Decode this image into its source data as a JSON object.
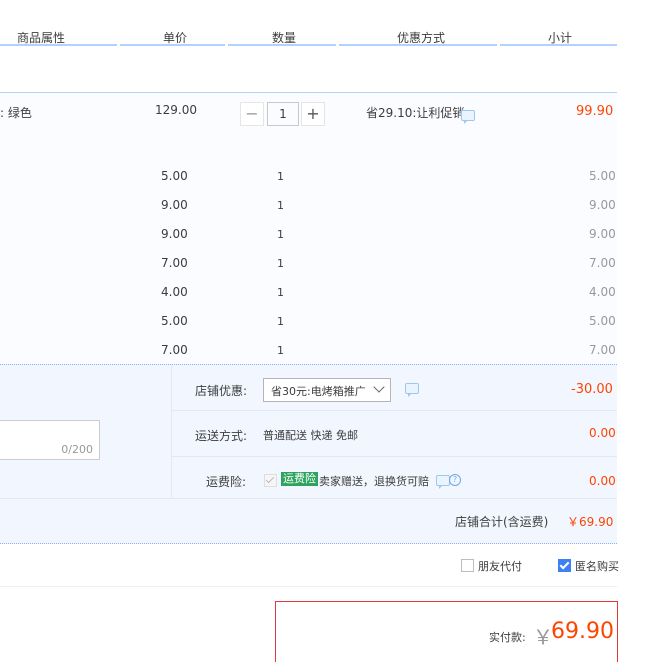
{
  "header": {
    "col_attr": "商品属性",
    "col_price": "单价",
    "col_qty": "数量",
    "col_promo": "优惠方式",
    "col_subtotal": "小计"
  },
  "main_item": {
    "attr": ": 绿色",
    "price": "129.00",
    "qty": "1",
    "minus": "−",
    "plus": "+",
    "promo": "省29.10:让利促销",
    "subtotal": "99.90"
  },
  "items": [
    {
      "price": "5.00",
      "qty": "1",
      "subtotal": "5.00"
    },
    {
      "price": "9.00",
      "qty": "1",
      "subtotal": "9.00"
    },
    {
      "price": "9.00",
      "qty": "1",
      "subtotal": "9.00"
    },
    {
      "price": "7.00",
      "qty": "1",
      "subtotal": "7.00"
    },
    {
      "price": "4.00",
      "qty": "1",
      "subtotal": "4.00"
    },
    {
      "price": "5.00",
      "qty": "1",
      "subtotal": "5.00"
    },
    {
      "price": "7.00",
      "qty": "1",
      "subtotal": "7.00"
    }
  ],
  "store": {
    "discount_label": "店铺优惠:",
    "discount_select": "省30元:电烤箱推广",
    "discount_amount": "-30.00",
    "shipping_label": "运送方式:",
    "shipping_value": "普通配送 快递 免邮",
    "shipping_amount": "0.00",
    "insurance_label": "运费险:",
    "insurance_badge": "运费险",
    "insurance_text": "卖家赠送，退换货可赔",
    "insurance_amount": "0.00",
    "message_counter": "0/200",
    "total_label": "店铺合计(含运费)",
    "total_value": "￥69.90"
  },
  "options": {
    "friend_pay": "朋友代付",
    "anonymous": "匿名购买"
  },
  "payment": {
    "label": "实付款:",
    "currency": "￥",
    "amount": "69.90"
  },
  "colors": {
    "accent": "#f40",
    "header_line": "#b2d1ff",
    "checkbox": "#3d80f6"
  }
}
